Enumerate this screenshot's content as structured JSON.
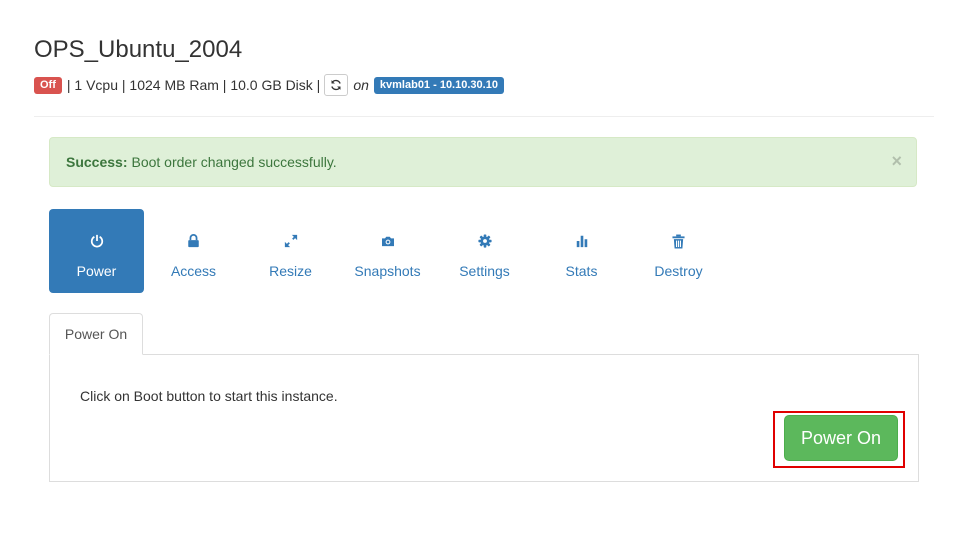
{
  "instance": {
    "name": "OPS_Ubuntu_2004",
    "status": "Off",
    "specs": "| 1 Vcpu | 1024 MB Ram | 10.0 GB Disk |",
    "on_label": "on",
    "host": "kvmlab01 - 10.10.30.10"
  },
  "alert": {
    "strong": "Success:",
    "message": "Boot order changed successfully.",
    "close": "×"
  },
  "tabs": [
    {
      "label": "Power",
      "icon": "power-icon",
      "active": true
    },
    {
      "label": "Access",
      "icon": "lock-icon",
      "active": false
    },
    {
      "label": "Resize",
      "icon": "resize-icon",
      "active": false
    },
    {
      "label": "Snapshots",
      "icon": "camera-icon",
      "active": false
    },
    {
      "label": "Settings",
      "icon": "gear-icon",
      "active": false
    },
    {
      "label": "Stats",
      "icon": "stats-icon",
      "active": false
    },
    {
      "label": "Destroy",
      "icon": "trash-icon",
      "active": false
    }
  ],
  "subtab": {
    "label": "Power On"
  },
  "panel": {
    "text": "Click on Boot button to start this instance.",
    "button": "Power On"
  },
  "colors": {
    "primary": "#337ab7",
    "success": "#5cb85c",
    "danger": "#d9534f",
    "highlight": "#e00000"
  }
}
